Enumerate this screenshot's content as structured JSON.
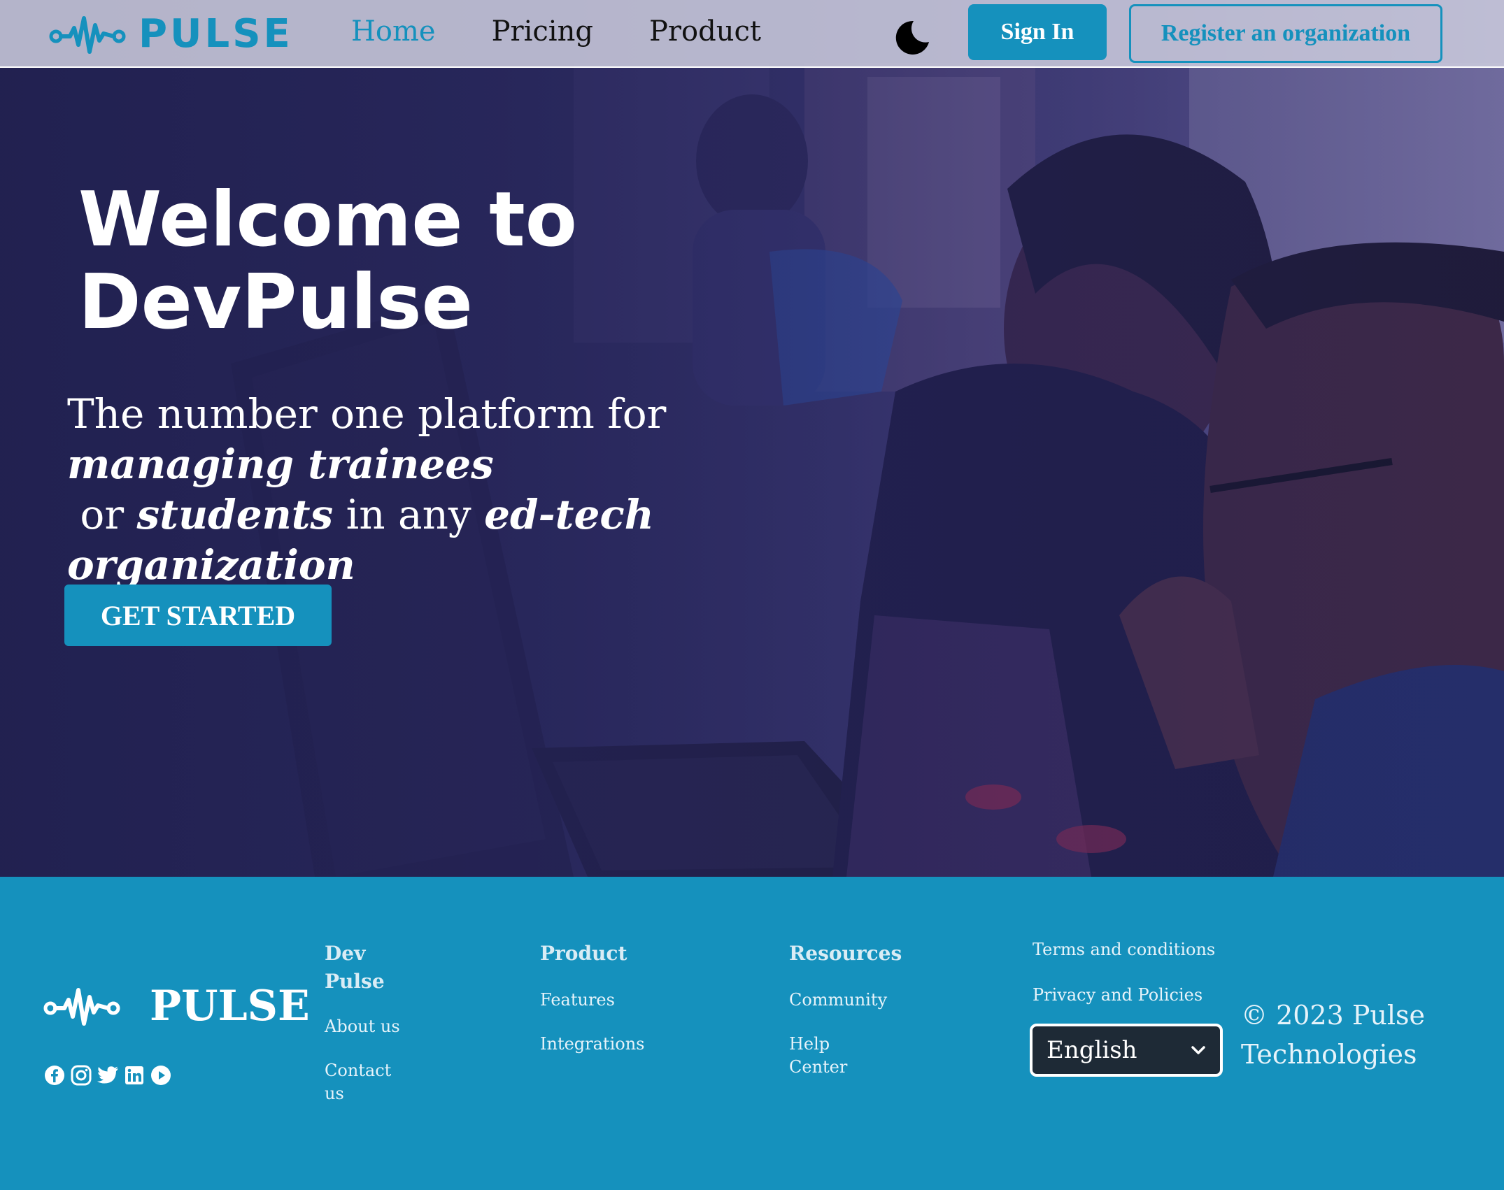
{
  "header": {
    "logo_text": "PULSE",
    "nav": [
      {
        "label": "Home",
        "active": true
      },
      {
        "label": "Pricing",
        "active": false
      },
      {
        "label": "Product",
        "active": false
      }
    ],
    "theme_toggle_icon": "moon-icon",
    "sign_in_label": "Sign In",
    "register_label": "Register an organization"
  },
  "hero": {
    "title_line1": "Welcome to",
    "title_line2": "DevPulse",
    "subtitle": {
      "part1": "The number one platform for",
      "emph1": "managing trainees",
      "part2": " or ",
      "emph2": "students",
      "part3": " in any ",
      "emph3": "ed-tech organization"
    },
    "cta_label": "GET STARTED"
  },
  "footer": {
    "logo_text": "PULSE",
    "socials": [
      "facebook-icon",
      "instagram-icon",
      "twitter-icon",
      "linkedin-icon",
      "youtube-icon"
    ],
    "col1": {
      "heading": "Dev Pulse",
      "links": [
        "About us",
        "Contact us"
      ]
    },
    "col2": {
      "heading": "Product",
      "links": [
        "Features",
        "Integrations"
      ]
    },
    "col3": {
      "heading": "Resources",
      "links": [
        "Community",
        "Help Center"
      ]
    },
    "legal": [
      "Terms and conditions",
      "Privacy and Policies"
    ],
    "language": "English",
    "copyright": "© 2023 Pulse Technologies"
  },
  "colors": {
    "brand": "#1591bd",
    "hero_overlay": "#26245a",
    "header_bg": "#cdcdde"
  }
}
